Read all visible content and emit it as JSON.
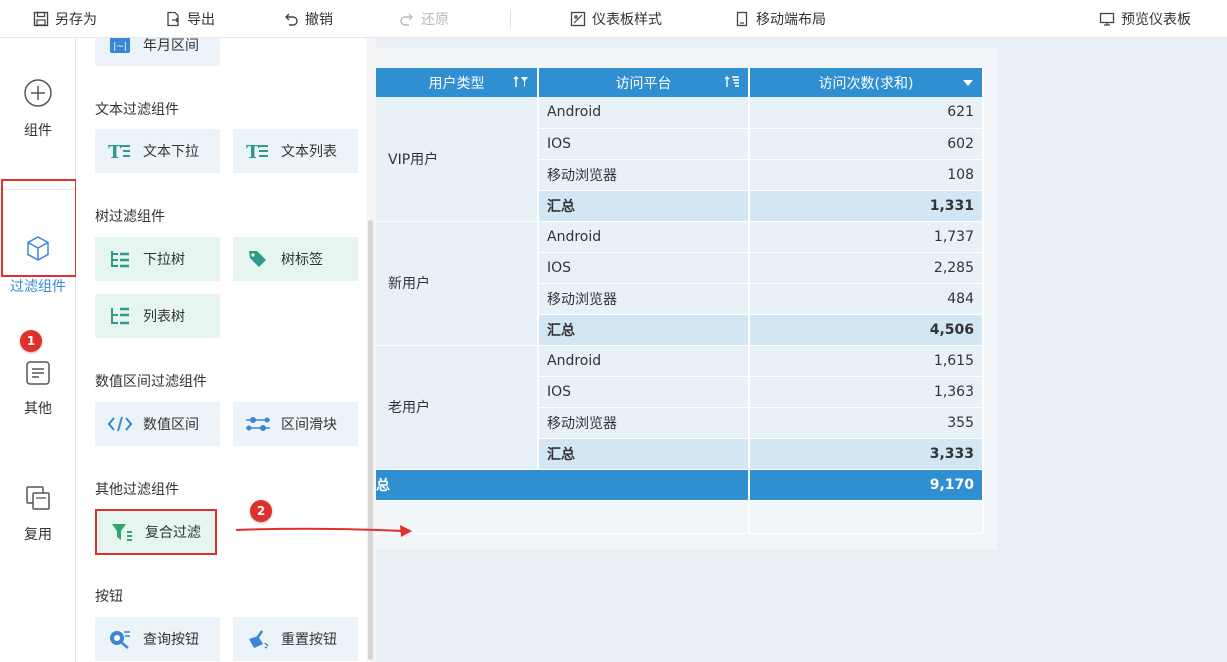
{
  "toolbar": {
    "save_as": "另存为",
    "export": "导出",
    "undo": "撤销",
    "redo": "还原",
    "dashboard_style": "仪表板样式",
    "mobile_layout": "移动端布局",
    "preview": "预览仪表板"
  },
  "leftnav": {
    "components": "组件",
    "filter_components": "过滤组件",
    "other": "其他",
    "reuse": "复用"
  },
  "badges": {
    "one": "1",
    "two": "2"
  },
  "panel": {
    "partial_item": "年月区间",
    "text_filter_title": "文本过滤组件",
    "text_dropdown": "文本下拉",
    "text_list": "文本列表",
    "tree_filter_title": "树过滤组件",
    "tree_dropdown": "下拉树",
    "tree_tag": "树标签",
    "tree_list": "列表树",
    "numeric_filter_title": "数值区间过滤组件",
    "numeric_range": "数值区间",
    "range_slider": "区间滑块",
    "other_filter_title": "其他过滤组件",
    "composite_filter": "复合过滤",
    "button_title": "按钮",
    "query_button": "查询按钮",
    "reset_button": "重置按钮"
  },
  "table": {
    "headers": {
      "user_type": "用户类型",
      "platform": "访问平台",
      "visits": "访问次数(求和)"
    },
    "groups": [
      {
        "type": "VIP用户",
        "rows": [
          {
            "platform": "Android",
            "value": "621"
          },
          {
            "platform": "IOS",
            "value": "602"
          },
          {
            "platform": "移动浏览器",
            "value": "108"
          }
        ],
        "subtotal_label": "汇总",
        "subtotal": "1,331"
      },
      {
        "type": "新用户",
        "rows": [
          {
            "platform": "Android",
            "value": "1,737"
          },
          {
            "platform": "IOS",
            "value": "2,285"
          },
          {
            "platform": "移动浏览器",
            "value": "484"
          }
        ],
        "subtotal_label": "汇总",
        "subtotal": "4,506"
      },
      {
        "type": "老用户",
        "rows": [
          {
            "platform": "Android",
            "value": "1,615"
          },
          {
            "platform": "IOS",
            "value": "1,363"
          },
          {
            "platform": "移动浏览器",
            "value": "355"
          }
        ],
        "subtotal_label": "汇总",
        "subtotal": "3,333"
      }
    ],
    "grand_total_label": "总",
    "grand_total": "9,170"
  },
  "colors": {
    "accent": "#2f8fd0",
    "highlight": "#e0302d",
    "active_nav": "#3b86d6"
  }
}
